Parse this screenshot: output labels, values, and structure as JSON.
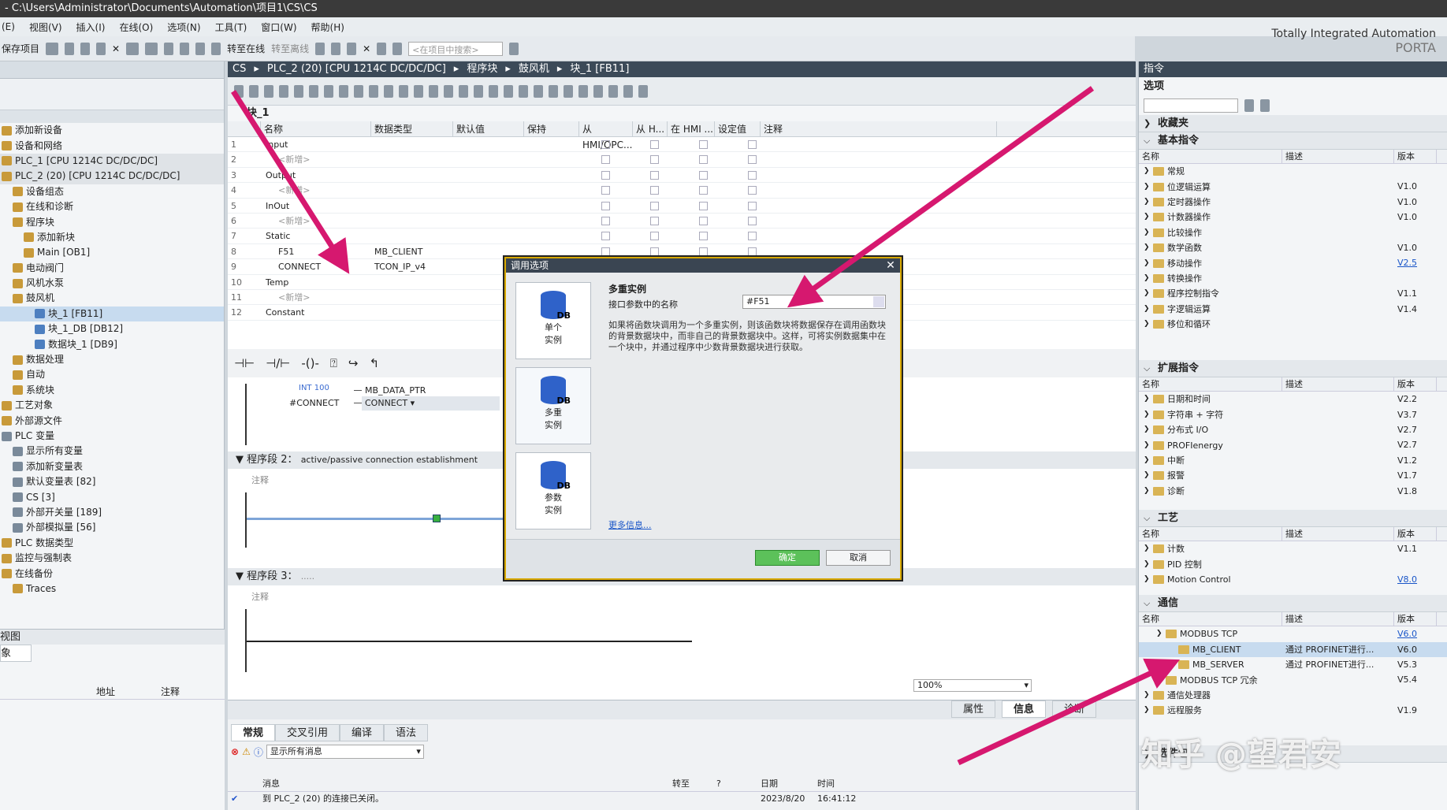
{
  "window": {
    "title": "- C:\\Users\\Administrator\\Documents\\Automation\\项目1\\CS\\CS"
  },
  "menu": [
    "(E)",
    "视图(V)",
    "插入(I)",
    "在线(O)",
    "选项(N)",
    "工具(T)",
    "窗口(W)",
    "帮助(H)"
  ],
  "toolbar": {
    "save": "保存项目",
    "go_online": "转至在线",
    "go_offline": "转至离线",
    "search_placeholder": "<在项目中搜索>"
  },
  "brand": {
    "line1": "Totally Integrated Automation",
    "line2": "PORTA"
  },
  "tree": [
    {
      "label": "添加新设备",
      "cls": ""
    },
    {
      "label": "设备和网络",
      "cls": ""
    },
    {
      "label": "PLC_1 [CPU 1214C DC/DC/DC]",
      "cls": "gray"
    },
    {
      "label": "PLC_2 (20) [CPU 1214C DC/DC/DC]",
      "cls": "gray"
    },
    {
      "label": "设备组态",
      "cls": ""
    },
    {
      "label": "在线和诊断",
      "cls": ""
    },
    {
      "label": "程序块",
      "cls": ""
    },
    {
      "label": "添加新块",
      "cls": ""
    },
    {
      "label": "Main [OB1]",
      "cls": ""
    },
    {
      "label": "电动阀门",
      "cls": ""
    },
    {
      "label": "风机水泵",
      "cls": ""
    },
    {
      "label": "鼓风机",
      "cls": ""
    },
    {
      "label": "块_1 [FB11]",
      "cls": "sel"
    },
    {
      "label": "块_1_DB [DB12]",
      "cls": ""
    },
    {
      "label": "数据块_1 [DB9]",
      "cls": ""
    },
    {
      "label": "数据处理",
      "cls": ""
    },
    {
      "label": "自动",
      "cls": ""
    },
    {
      "label": "系统块",
      "cls": ""
    },
    {
      "label": "工艺对象",
      "cls": ""
    },
    {
      "label": "外部源文件",
      "cls": ""
    },
    {
      "label": "PLC 变量",
      "cls": ""
    },
    {
      "label": "显示所有变量",
      "cls": ""
    },
    {
      "label": "添加新变量表",
      "cls": ""
    },
    {
      "label": "默认变量表 [82]",
      "cls": ""
    },
    {
      "label": "CS [3]",
      "cls": ""
    },
    {
      "label": "外部开关量 [189]",
      "cls": ""
    },
    {
      "label": "外部模拟量 [56]",
      "cls": ""
    },
    {
      "label": "PLC 数据类型",
      "cls": ""
    },
    {
      "label": "监控与强制表",
      "cls": ""
    },
    {
      "label": "在线备份",
      "cls": ""
    },
    {
      "label": "Traces",
      "cls": ""
    }
  ],
  "lower_left": {
    "view": "视图",
    "obj": "象",
    "col_addr": "地址",
    "col_note": "注释"
  },
  "breadcrumb": [
    "CS",
    "PLC_2 (20) [CPU 1214C DC/DC/DC]",
    "程序块",
    "鼓风机",
    "块_1 [FB11]"
  ],
  "block_title": "块_1",
  "iface_headers": [
    "名称",
    "数据类型",
    "默认值",
    "保持",
    "从 HMI/OPC...",
    "从 H...",
    "在 HMI ...",
    "设定值",
    "注释"
  ],
  "iface_rows": [
    {
      "n": "1",
      "name": "Input",
      "type": ""
    },
    {
      "n": "2",
      "name": "<新增>",
      "type": ""
    },
    {
      "n": "3",
      "name": "Output",
      "type": ""
    },
    {
      "n": "4",
      "name": "<新增>",
      "type": ""
    },
    {
      "n": "5",
      "name": "InOut",
      "type": ""
    },
    {
      "n": "6",
      "name": "<新增>",
      "type": ""
    },
    {
      "n": "7",
      "name": "Static",
      "type": ""
    },
    {
      "n": "8",
      "name": "F51",
      "type": "MB_CLIENT"
    },
    {
      "n": "9",
      "name": "CONNECT",
      "type": "TCON_IP_v4"
    },
    {
      "n": "10",
      "name": "Temp",
      "type": ""
    },
    {
      "n": "11",
      "name": "<新增>",
      "type": ""
    },
    {
      "n": "12",
      "name": "Constant",
      "type": ""
    }
  ],
  "ladder": {
    "p1_int": "INT 100",
    "p1_mbdata": "MB_DATA_PTR",
    "p1_conn_tag": "#CONNECT",
    "p1_conn": "CONNECT",
    "seg2_title": "程序段 2：",
    "seg2_desc": "active/passive connection establishment",
    "seg2_note": "注释",
    "seg3_title": "程序段 3：",
    "seg3_desc": ".....",
    "seg3_note": "注释",
    "zoom": "100%"
  },
  "dialog": {
    "title": "调用选项",
    "opt_single": "单个\n实例",
    "opt_multi": "多重\n实例",
    "opt_param": "参数\n实例",
    "heading": "多重实例",
    "field_label": "接口参数中的名称",
    "field_value": "#F51",
    "description": "如果将函数块调用为一个多重实例，则该函数块将数据保存在调用函数块的背景数据块中，而非自己的背景数据块中。这样，可将实例数据集中在一个块中，并通过程序中少数背景数据块进行获取。",
    "more_info": "更多信息...",
    "ok": "确定",
    "cancel": "取消"
  },
  "right": {
    "header": "指令",
    "options": "选项",
    "favorites": "收藏夹",
    "basic": "基本指令",
    "extended": "扩展指令",
    "tech": "工艺",
    "comm": "通信",
    "packages": "选件包",
    "cols": [
      "名称",
      "描述",
      "版本"
    ],
    "basic_rows": [
      {
        "name": "常规",
        "desc": "",
        "ver": ""
      },
      {
        "name": "位逻辑运算",
        "desc": "",
        "ver": "V1.0"
      },
      {
        "name": "定时器操作",
        "desc": "",
        "ver": "V1.0"
      },
      {
        "name": "计数器操作",
        "desc": "",
        "ver": "V1.0"
      },
      {
        "name": "比较操作",
        "desc": "",
        "ver": ""
      },
      {
        "name": "数学函数",
        "desc": "",
        "ver": "V1.0"
      },
      {
        "name": "移动操作",
        "desc": "",
        "ver": "V2.5",
        "link": true
      },
      {
        "name": "转换操作",
        "desc": "",
        "ver": ""
      },
      {
        "name": "程序控制指令",
        "desc": "",
        "ver": "V1.1"
      },
      {
        "name": "字逻辑运算",
        "desc": "",
        "ver": "V1.4"
      },
      {
        "name": "移位和循环",
        "desc": "",
        "ver": ""
      }
    ],
    "ext_rows": [
      {
        "name": "日期和时间",
        "desc": "",
        "ver": "V2.2"
      },
      {
        "name": "字符串 + 字符",
        "desc": "",
        "ver": "V3.7"
      },
      {
        "name": "分布式 I/O",
        "desc": "",
        "ver": "V2.7"
      },
      {
        "name": "PROFIenergy",
        "desc": "",
        "ver": "V2.7"
      },
      {
        "name": "中断",
        "desc": "",
        "ver": "V1.2"
      },
      {
        "name": "报警",
        "desc": "",
        "ver": "V1.7"
      },
      {
        "name": "诊断",
        "desc": "",
        "ver": "V1.8"
      }
    ],
    "tech_rows": [
      {
        "name": "计数",
        "desc": "",
        "ver": "V1.1"
      },
      {
        "name": "PID 控制",
        "desc": "",
        "ver": ""
      },
      {
        "name": "Motion Control",
        "desc": "",
        "ver": "V8.0",
        "link": true
      }
    ],
    "comm_rows": [
      {
        "name": "MODBUS TCP",
        "desc": "",
        "ver": "V6.0",
        "link": true,
        "indent": 1
      },
      {
        "name": "MB_CLIENT",
        "desc": "通过 PROFINET进行...",
        "ver": "V6.0",
        "indent": 2,
        "sel": true
      },
      {
        "name": "MB_SERVER",
        "desc": "通过 PROFINET进行...",
        "ver": "V5.3",
        "indent": 2
      },
      {
        "name": "MODBUS TCP 冗余",
        "desc": "",
        "ver": "V5.4",
        "indent": 1
      },
      {
        "name": "通信处理器",
        "desc": "",
        "ver": "",
        "indent": 0
      },
      {
        "name": "远程服务",
        "desc": "",
        "ver": "V1.9",
        "indent": 0
      }
    ]
  },
  "bottom": {
    "tabs": [
      "常规",
      "交叉引用",
      "编译",
      "语法"
    ],
    "right_tabs": [
      "属性",
      "信息",
      "诊断"
    ],
    "filter": "显示所有消息",
    "cols": [
      "消息",
      "转至",
      "?",
      "日期",
      "时间"
    ],
    "msg": "到 PLC_2 (20) 的连接已关闭。",
    "date": "2023/8/20",
    "time": "16:41:12"
  },
  "watermark": "知乎 @望君安",
  "colors": {
    "arrow": "#d6186f",
    "accent": "#d8a800"
  }
}
